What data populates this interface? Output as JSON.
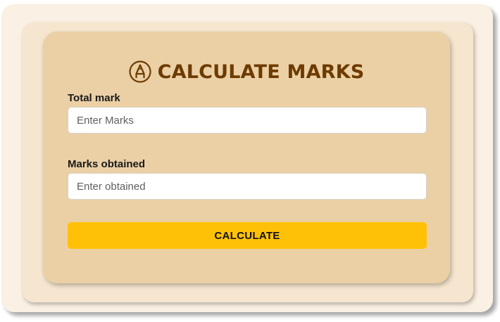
{
  "form": {
    "title": "CALCULATE MARKS",
    "title_icon": "pencil-circle-icon",
    "total_mark_label": "Total mark",
    "total_mark_placeholder": "Enter Marks",
    "total_mark_value": "",
    "obtained_label": "Marks obtained",
    "obtained_placeholder": "Enter obtained",
    "obtained_value": "",
    "calculate_label": "CALCULATE"
  },
  "colors": {
    "title": "#6d3b00",
    "card_background": "#ebd0a6",
    "button": "#ffc107",
    "outer_frame": "#faf0e3",
    "inner_frame": "#f7e6cf"
  }
}
